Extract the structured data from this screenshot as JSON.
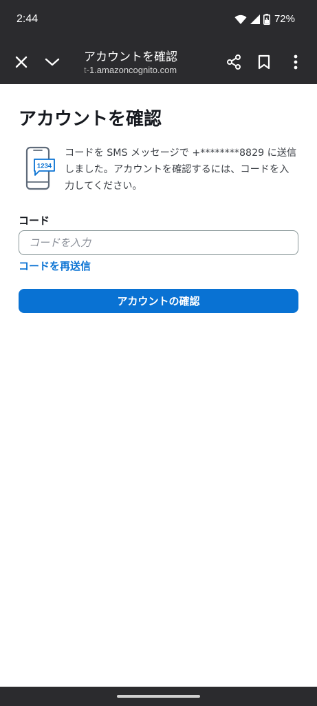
{
  "status_bar": {
    "time": "2:44",
    "battery": "72%",
    "icons": [
      "wifi-icon",
      "cell-signal-icon",
      "battery-charging-icon"
    ]
  },
  "browser_toolbar": {
    "title": "アカウントを確認",
    "url_dim": "t-",
    "url_main": "1.amazoncognito.com",
    "icons": [
      "close-icon",
      "chevron-down-icon",
      "share-icon",
      "bookmark-icon",
      "more-vert-icon"
    ]
  },
  "page": {
    "title": "アカウントを確認",
    "sms_message": "コードを SMS メッセージで +********8829 に送信しました。アカウントを確認するには、コードを入力してください。",
    "phone_icon_code": "1234",
    "code_label": "コード",
    "code_placeholder": "コードを入力",
    "resend_link": "コードを再送信",
    "confirm_button": "アカウントの確認"
  },
  "colors": {
    "accent": "#0972d3",
    "chrome": "#2b2b2e",
    "text": "#16191f"
  }
}
